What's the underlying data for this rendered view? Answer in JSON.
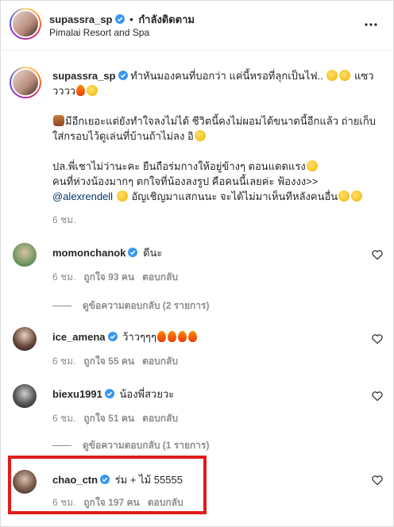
{
  "header": {
    "username": "supassra_sp",
    "separator": "•",
    "follow_label": "กำลังติดตาม",
    "location": "Pimalai Resort and Spa",
    "more_icon": "more-horizontal-icon"
  },
  "caption": {
    "username": "supassra_sp",
    "line1": "ทำหันมองคนที่บอกว่า แค่นี้หรอที่ลุกเป็นไฟ..",
    "line1_tail": "แซววววว",
    "para2": "มีอีกเยอะแต่ยังทำใจลงไม่ได้ ชีวิตนี้คงไม่ผอมได้ขนาดนี้อีกแล้ว ถ่ายเก็บใส่กรอบไว้ดูเล่นที่บ้านถ้าไม่ลง อิ",
    "para3_a": "ปล.พี่เชาไม่ว่านะคะ ยืนถือร่มกางให้อยู่ข้างๆ ตอนแดดแรง",
    "para3_b": "คนที่ห่วงน้องมากๆ ตกใจที่น้องลงรูป คือคนนี้เลยค่ะ ฟ้องงง>>",
    "mention": "@alexrendell",
    "para3_c": "อัญเชิญมาแสกนนะ จะได้ไม่มาเห็นทีหลังคนอื่น",
    "time": "6 ชม."
  },
  "comments": [
    {
      "username": "momonchanok",
      "text": "ดีนะ",
      "time": "6 ชม.",
      "likes": "ถูกใจ 93 คน",
      "reply": "ตอบกลับ",
      "view_replies": "ดูข้อความตอบกลับ (2 รายการ)"
    },
    {
      "username": "ice_amena",
      "text": "ว้าวๆๆๆ",
      "time": "6 ชม.",
      "likes": "ถูกใจ 55 คน",
      "reply": "ตอบกลับ"
    },
    {
      "username": "biexu1991",
      "text": "น้องพี่สวยวะ",
      "time": "6 ชม.",
      "likes": "ถูกใจ 51 คน",
      "reply": "ตอบกลับ",
      "view_replies": "ดูข้อความตอบกลับ (1 รายการ)"
    },
    {
      "username": "chao_ctn",
      "text": "ร่ม + ไม้ 55555",
      "time": "6 ชม.",
      "likes": "ถูกใจ 197 คน",
      "reply": "ตอบกลับ"
    }
  ],
  "colors": {
    "accent_highlight": "#e01c1c",
    "verified": "#3897f0",
    "mention": "#00376b"
  }
}
